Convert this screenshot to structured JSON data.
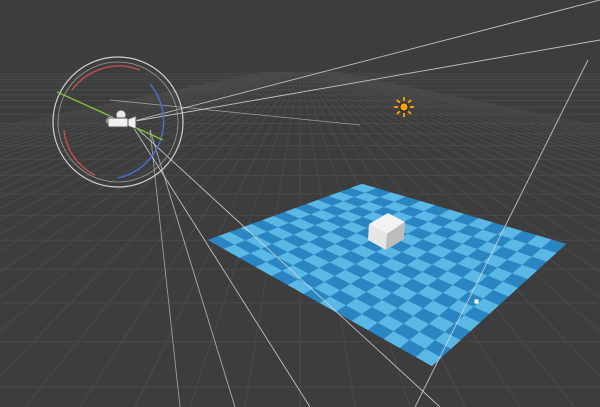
{
  "viewport": {
    "background_color": "#3d3d3d",
    "grid_color": "#4a4a4a",
    "frustum_color": "#d9d9d9"
  },
  "scene": {
    "objects": [
      {
        "id": "camera",
        "icon": "camera-icon",
        "type": "camera",
        "selected": true
      },
      {
        "id": "sun",
        "icon": "sun-icon",
        "type": "light",
        "color": "#ffa500"
      },
      {
        "id": "cube",
        "icon": "cube-icon",
        "type": "mesh",
        "color": "#e6e6e6"
      },
      {
        "id": "plane",
        "type": "mesh",
        "colors": [
          "#2a86c2",
          "#5ab8e6"
        ]
      }
    ],
    "gizmo": {
      "rotate_x_color": "#c05050",
      "rotate_y_color": "#86c038",
      "rotate_z_color": "#4a6fd0",
      "ring_color": "#cfcfcf"
    }
  }
}
